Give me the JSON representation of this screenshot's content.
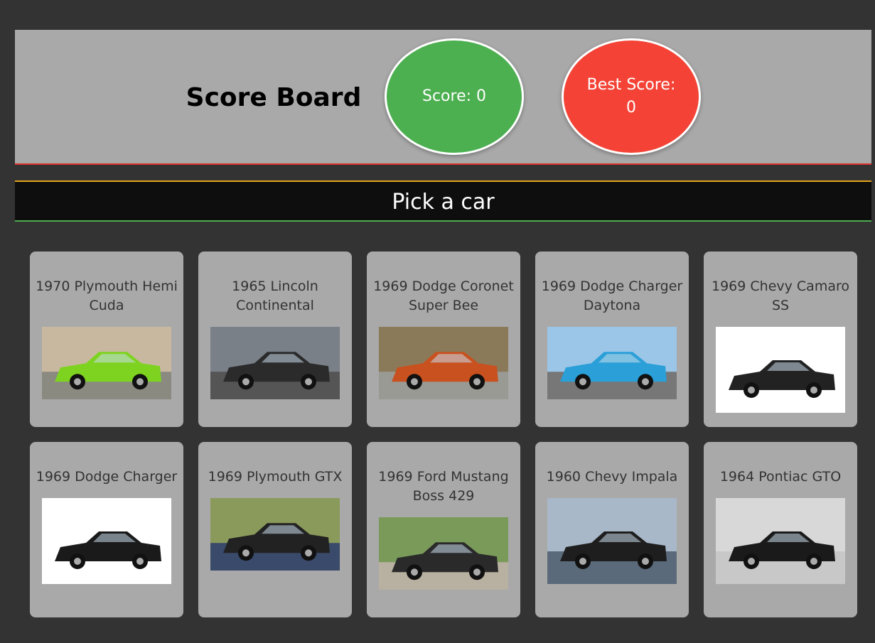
{
  "scoreboard": {
    "title": "Score Board",
    "score_label": "Score: 0",
    "best_label": "Best Score: 0",
    "colors": {
      "score": "#4caf50",
      "best": "#f44336"
    }
  },
  "prompt": "Pick a car",
  "cards": [
    {
      "name": "1970 Plymouth Hemi Cuda",
      "car_color": "#7ed321",
      "bg": "#c9b8a0",
      "ground": "#8a8a80"
    },
    {
      "name": "1965 Lincoln Continental",
      "car_color": "#2b2b2b",
      "bg": "#7a8088",
      "ground": "#555"
    },
    {
      "name": "1969 Dodge Coronet Super Bee",
      "car_color": "#c8511f",
      "bg": "#8a7a5a",
      "ground": "#9a9a95"
    },
    {
      "name": "1969 Dodge Charger Daytona",
      "car_color": "#2a9fd8",
      "bg": "#9cc6e8",
      "ground": "#777"
    },
    {
      "name": "1969 Chevy Camaro SS",
      "car_color": "#222222",
      "bg": "#ffffff",
      "ground": "#ffffff"
    },
    {
      "name": "1969 Dodge Charger",
      "car_color": "#1a1a1a",
      "bg": "#ffffff",
      "ground": "#ffffff"
    },
    {
      "name": "1969 Plymouth GTX",
      "car_color": "#222222",
      "bg": "#8a9a5a",
      "ground": "#3a4a6a"
    },
    {
      "name": "1969 Ford Mustang Boss 429",
      "car_color": "#2a2a2a",
      "bg": "#7a9a5a",
      "ground": "#b8b0a0"
    },
    {
      "name": "1960 Chevy Impala",
      "car_color": "#1e1e1e",
      "bg": "#a8b8c8",
      "ground": "#5a6a7a"
    },
    {
      "name": "1964 Pontiac GTO",
      "car_color": "#1a1a1a",
      "bg": "#d8d8d8",
      "ground": "#c8c8c8"
    }
  ]
}
